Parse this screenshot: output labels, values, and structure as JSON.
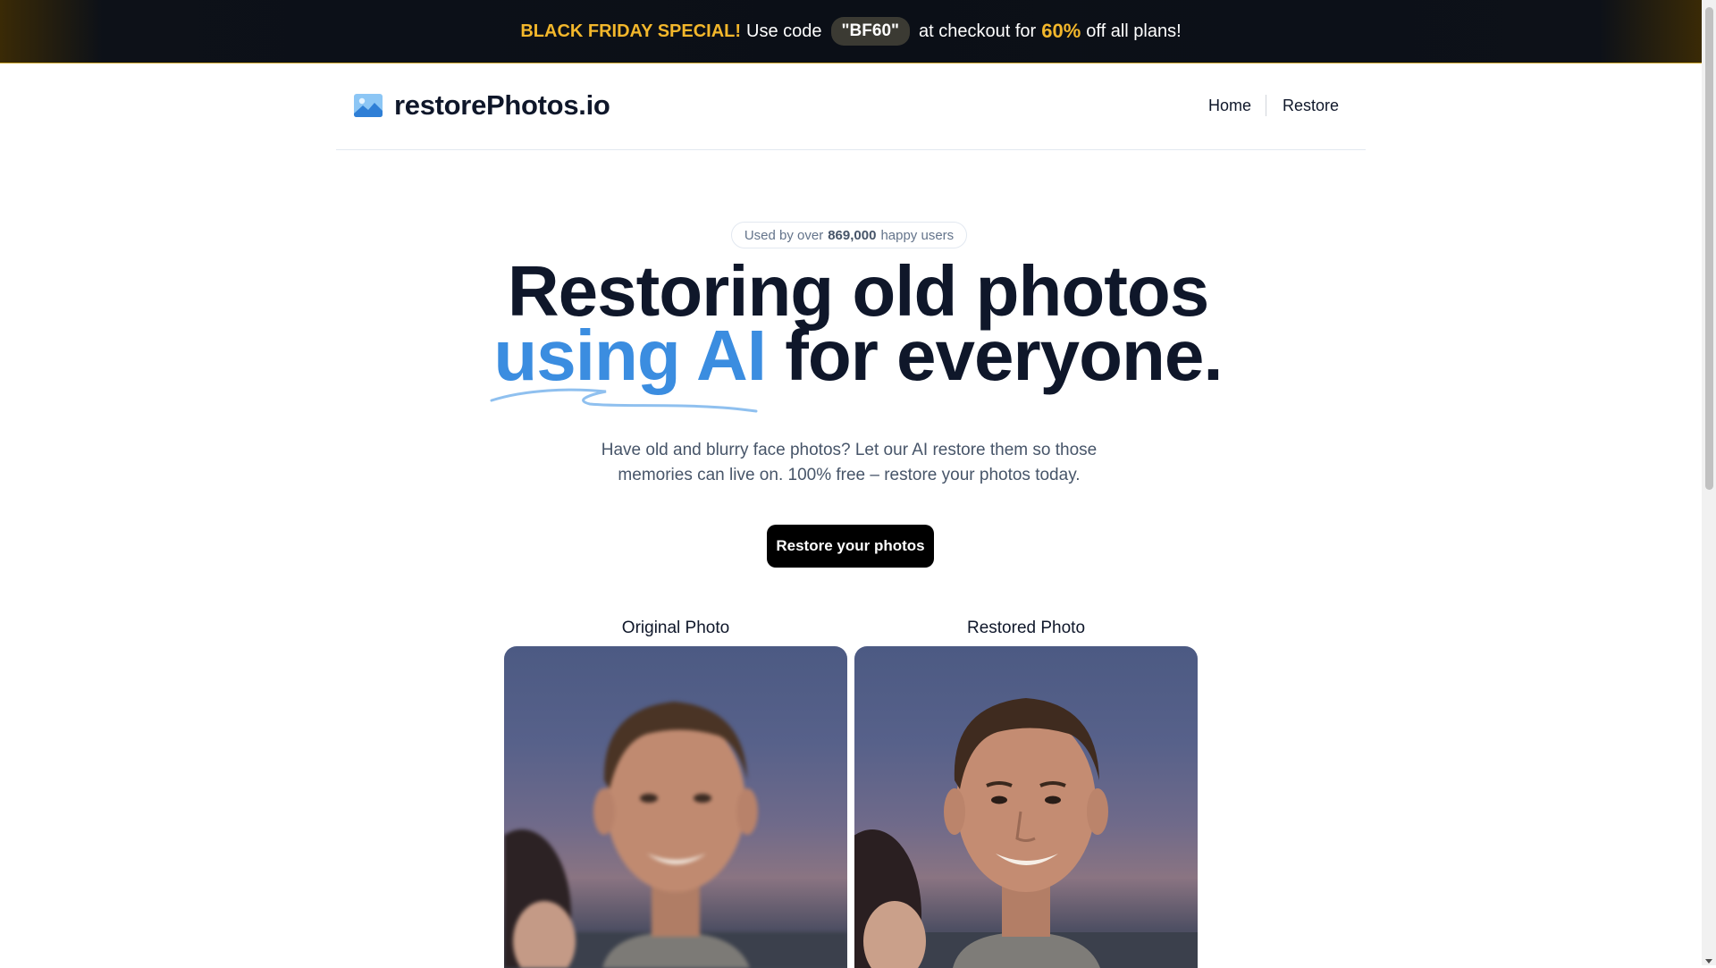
{
  "promo": {
    "highlight": "BLACK FRIDAY SPECIAL!",
    "use_code": "Use code",
    "code": "\"BF60\"",
    "at_checkout": "at checkout for",
    "discount": "60%",
    "suffix": "off all plans!"
  },
  "brand": {
    "name": "restorePhotos.io",
    "logo_icon": "image-icon"
  },
  "nav": {
    "home": "Home",
    "restore": "Restore"
  },
  "badge": {
    "prefix": "Used by over",
    "count": "869,000",
    "suffix": "happy users"
  },
  "hero": {
    "line1": "Restoring old photos",
    "highlight": "using AI",
    "rest": "for everyone.",
    "description": "Have old and blurry face photos? Let our AI restore them so those memories can live on. 100% free – restore your photos today.",
    "cta": "Restore your photos"
  },
  "comparison": {
    "original_label": "Original Photo",
    "restored_label": "Restored Photo"
  },
  "colors": {
    "accent_blue": "#3b8de0",
    "promo_gold": "#f3b72b",
    "text_dark": "#0f172a"
  }
}
